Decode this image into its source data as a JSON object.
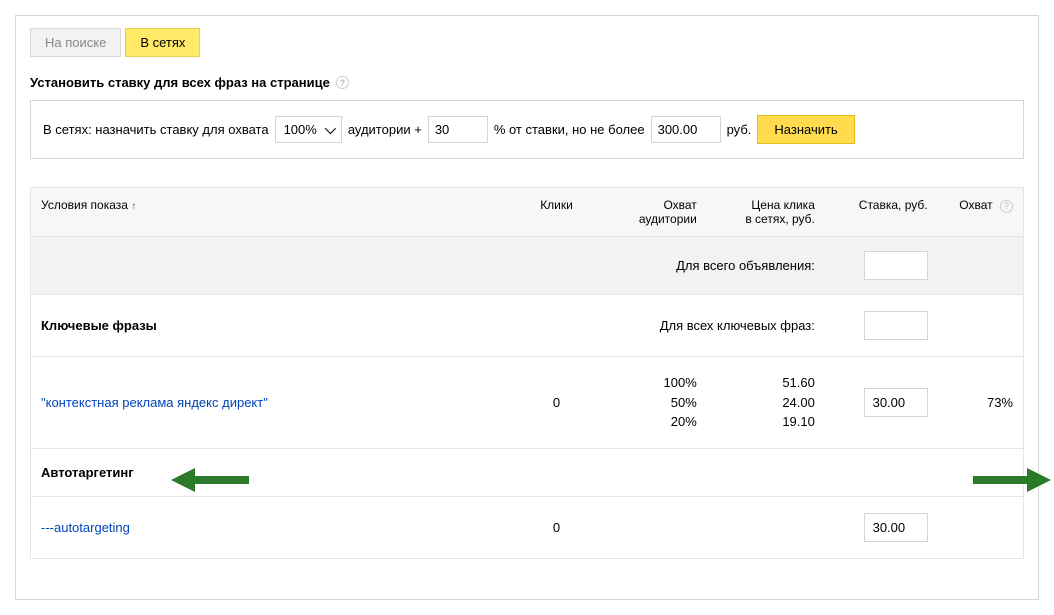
{
  "tabs": {
    "search": "На поиске",
    "networks": "В сетях"
  },
  "sectionTitle": "Установить ставку для всех фраз на странице",
  "bidRow": {
    "prefix": "В сетях:  назначить ставку для охвата",
    "coverageSelect": "100%",
    "audiencePlus": "аудитории +",
    "percentValue": "30",
    "percentSuffix": "% от ставки, но не более",
    "maxValue": "300.00",
    "currency": "руб.",
    "applyBtn": "Назначить"
  },
  "headers": {
    "conditions": "Условия показа",
    "sortArrow": "↑",
    "clicks": "Клики",
    "coverage1": "Охват",
    "coverage2": "аудитории",
    "price1": "Цена клика",
    "price2": "в сетях, руб.",
    "bid": "Ставка, руб.",
    "reach": "Охват"
  },
  "filterRow": {
    "forAllAd": "Для всего объявления:"
  },
  "groups": {
    "keywords": "Ключевые фразы",
    "keywordsFilter": "Для всех ключевых фраз:",
    "autotargeting": "Автотаргетинг"
  },
  "rows": {
    "kw": {
      "phrase": "\"контекстная реклама яндекс директ\"",
      "clicks": "0",
      "cov": [
        "100%",
        "50%",
        "20%"
      ],
      "price": [
        "51.60",
        "24.00",
        "19.10"
      ],
      "bid": "30.00",
      "reach": "73%"
    },
    "auto": {
      "phrase": "---autotargeting",
      "clicks": "0",
      "bid": "30.00"
    }
  }
}
